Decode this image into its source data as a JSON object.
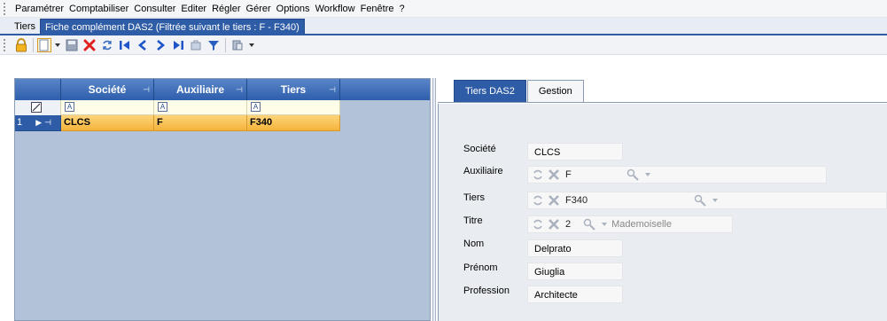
{
  "menu": [
    "Paramétrer",
    "Comptabiliser",
    "Consulter",
    "Editer",
    "Régler",
    "Gérer",
    "Options",
    "Workflow",
    "Fenêtre",
    "?"
  ],
  "doc_tabs": [
    {
      "label": "Tiers"
    },
    {
      "label": "Fiche complément DAS2 (Filtrée suivant le tiers : F - F340)"
    }
  ],
  "grid": {
    "columns": [
      "Société",
      "Auxiliaire",
      "Tiers"
    ],
    "filter_glyph": "A",
    "rows": [
      {
        "num": "1",
        "societe": "CLCS",
        "auxiliaire": "F",
        "tiers": "F340"
      }
    ]
  },
  "form_tabs": [
    "Tiers DAS2",
    "Gestion"
  ],
  "form": {
    "societe": {
      "label": "Société",
      "value": "CLCS"
    },
    "auxiliaire": {
      "label": "Auxiliaire",
      "value": "F"
    },
    "tiers": {
      "label": "Tiers",
      "value": "F340"
    },
    "titre": {
      "label": "Titre",
      "value": "2",
      "description": "Mademoiselle"
    },
    "nom": {
      "label": "Nom",
      "value": "Delprato"
    },
    "prenom": {
      "label": "Prénom",
      "value": "Giuglia"
    },
    "profession": {
      "label": "Profession",
      "value": "Architecte"
    }
  },
  "colors": {
    "accent": "#2f5ca6",
    "selected_row": "#f5b43a",
    "grid_bg": "#b2c2d9"
  }
}
